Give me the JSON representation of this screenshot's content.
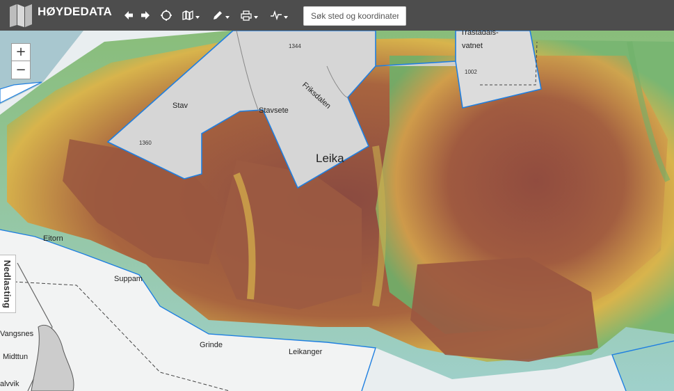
{
  "app": {
    "title": "HØYDEDATA"
  },
  "toolbar": {
    "tools": [
      {
        "name": "back-arrow-icon"
      },
      {
        "name": "forward-arrow-icon"
      },
      {
        "name": "locate-icon"
      },
      {
        "name": "map-layers-icon"
      },
      {
        "name": "draw-pencil-icon"
      },
      {
        "name": "print-icon"
      },
      {
        "name": "elevation-profile-icon"
      }
    ]
  },
  "search": {
    "placeholder": "Søk sted og koordinater"
  },
  "zoom": {
    "in_label": "+",
    "out_label": "−"
  },
  "side_panel": {
    "label": "Nedlasting"
  },
  "map_labels": {
    "trastadals": "Trastadals-",
    "vatnet": "vatnet",
    "h1344": "1344",
    "h1002": "1002",
    "h1360": "1360",
    "friksdalen": "Friksdalen",
    "stav": "Stav",
    "stavsete": "Stavsete",
    "leika": "Leika",
    "eitorn": "Eitorn",
    "suppam": "Suppam",
    "vangsnes": "Vangsnes",
    "midttun": "Midttun",
    "alvvik": "alvvik",
    "grinde": "Grinde",
    "leikanger": "Leikanger"
  },
  "colors": {
    "toolbar": "#4d4d4d",
    "boundary": "#1f7fe0",
    "water": "#dfe9ee",
    "terrain_low": "#5fae63",
    "terrain_mid": "#e0b54a",
    "terrain_high": "#8c4a3e"
  }
}
